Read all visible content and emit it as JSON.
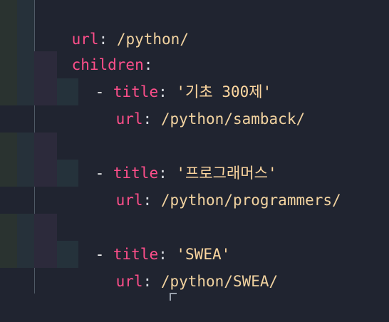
{
  "editor": {
    "lines": [
      {
        "key": "url",
        "sep": ": ",
        "value": "/python/"
      },
      {
        "key": "children",
        "sep": ":"
      },
      {
        "dash": "- ",
        "key": "title",
        "sep": ": ",
        "value": "'기초 300제'"
      },
      {
        "key": "url",
        "sep": ": ",
        "value": "/python/samback/"
      },
      {
        "dash": "- ",
        "key": "title",
        "sep": ": ",
        "value": "'프로그래머스'"
      },
      {
        "key": "url",
        "sep": ": ",
        "value": "/python/programmers/"
      },
      {
        "dash": "- ",
        "key": "title",
        "sep": ": ",
        "value": "'SWEA'"
      },
      {
        "key": "url",
        "sep": ": ",
        "value": "/python/SWEA/"
      }
    ]
  },
  "colors": {
    "background": "#202430",
    "key": "#ff4f8b",
    "string": "#ffd8a0",
    "value": "#f2d3a0"
  }
}
